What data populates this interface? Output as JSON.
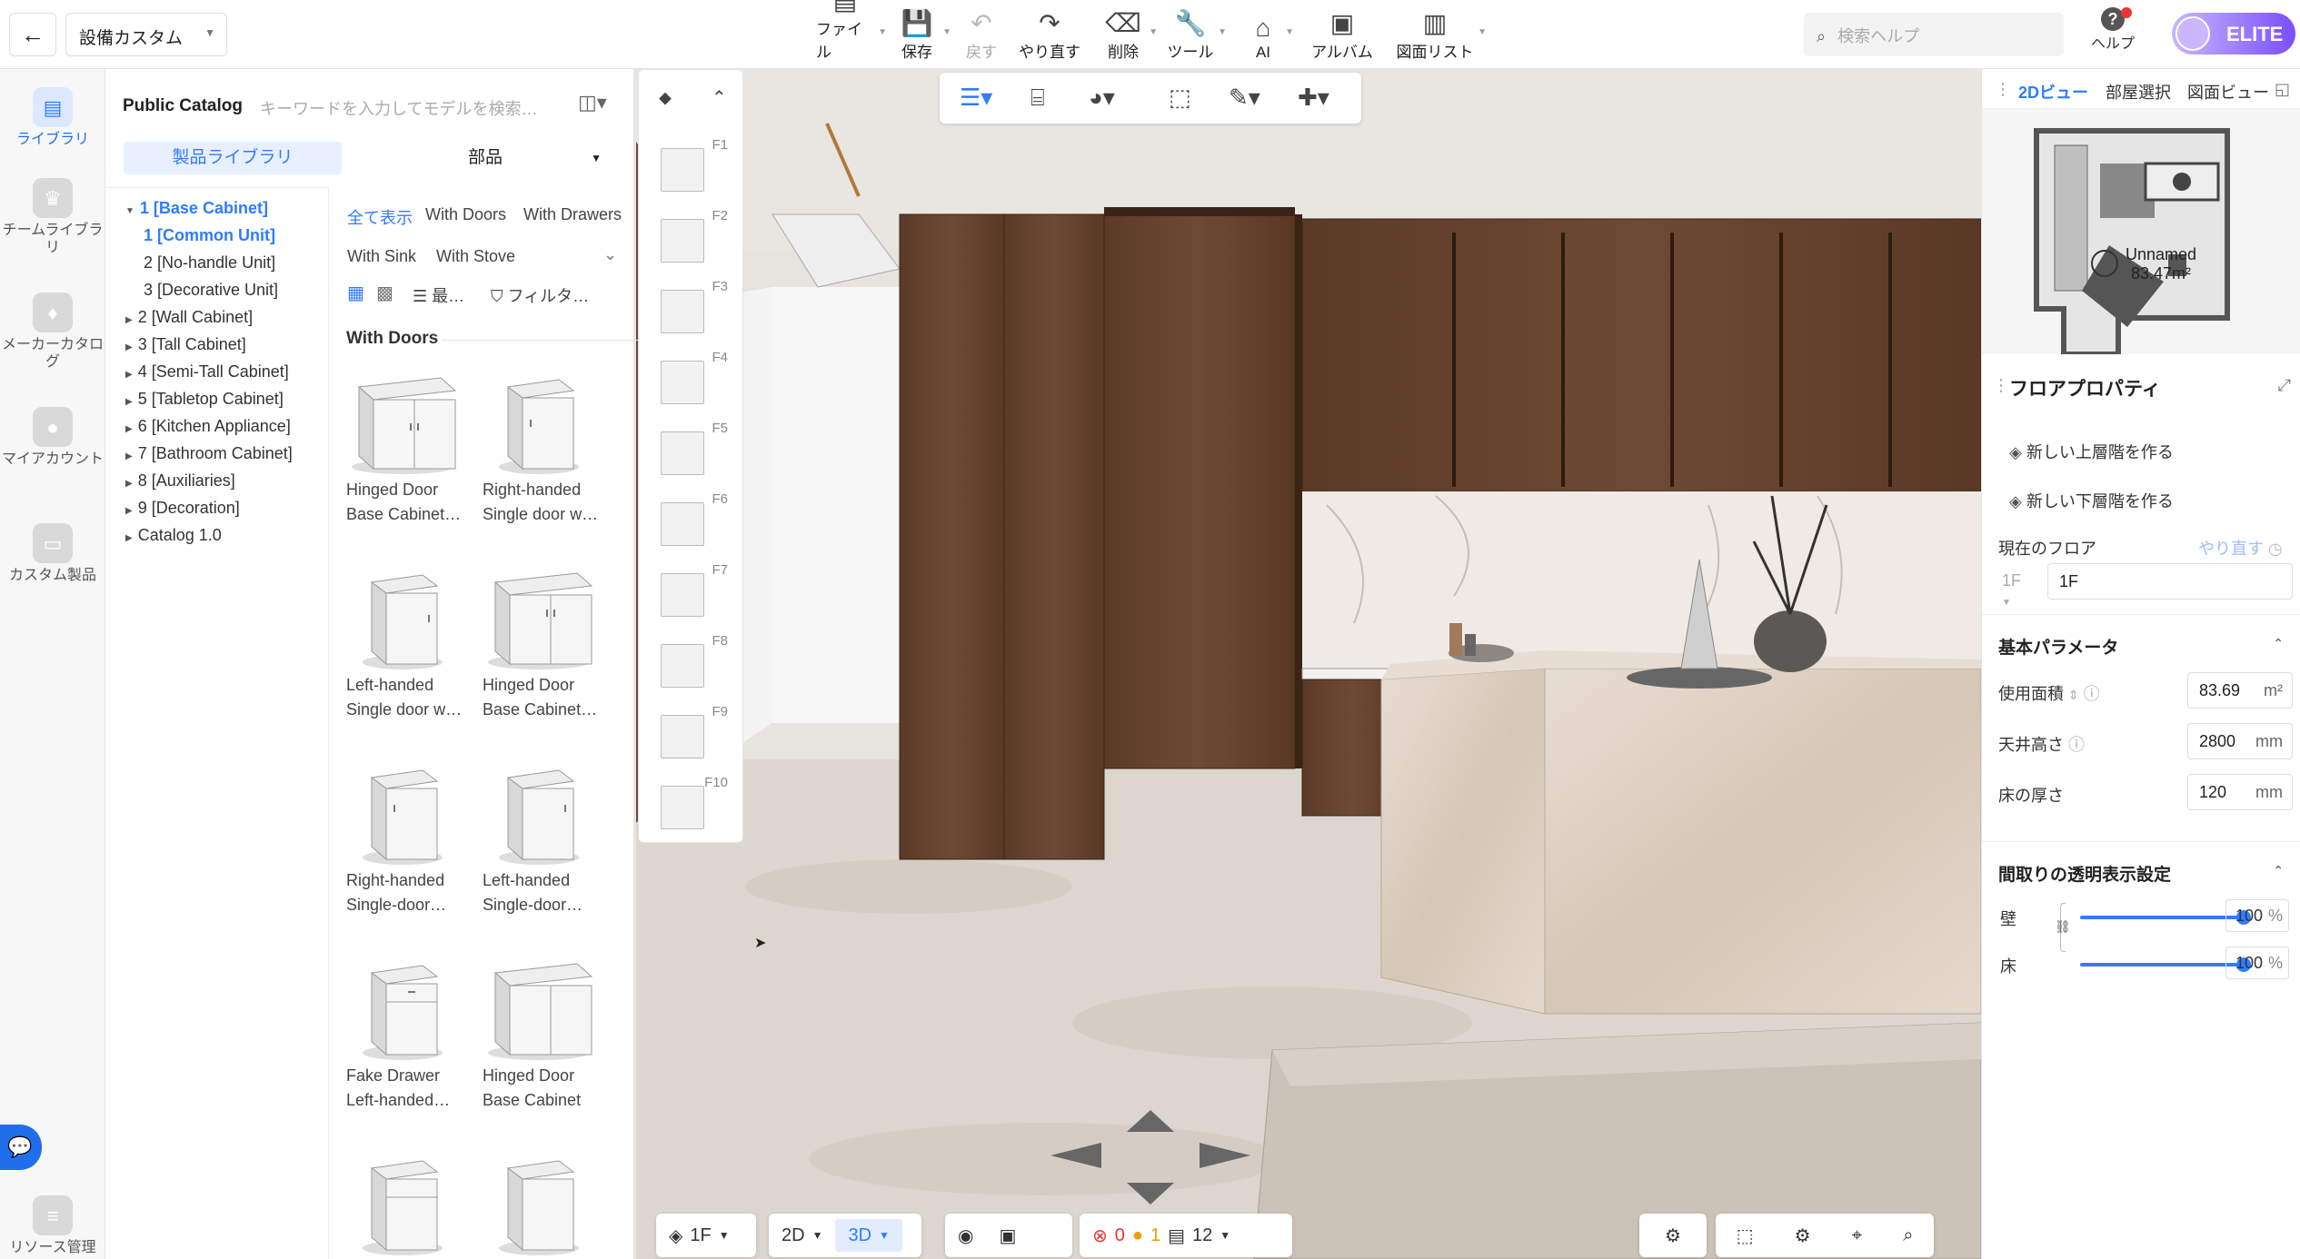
{
  "topbar": {
    "project": "設備カスタム",
    "items": [
      {
        "label": "ファイル",
        "icon": "file-icon"
      },
      {
        "label": "保存",
        "icon": "save-icon"
      },
      {
        "label": "戻す",
        "icon": "undo-icon"
      },
      {
        "label": "やり直す",
        "icon": "redo-icon"
      },
      {
        "label": "削除",
        "icon": "eraser-icon"
      },
      {
        "label": "ツール",
        "icon": "wrench-icon"
      },
      {
        "label": "AI",
        "icon": "ai-icon"
      },
      {
        "label": "アルバム",
        "icon": "album-icon"
      },
      {
        "label": "図面リスト",
        "icon": "drawing-list-icon"
      }
    ],
    "search_placeholder": "検索ヘルプ",
    "help_label": "ヘルプ",
    "badge": "ELITE"
  },
  "leftnav": [
    {
      "label": "ライブラリ",
      "icon": "library-icon",
      "active": true
    },
    {
      "label": "チームライブラリ",
      "icon": "team-library-icon"
    },
    {
      "label": "メーカーカタログ",
      "icon": "maker-catalog-icon"
    },
    {
      "label": "マイアカウント",
      "icon": "account-icon"
    },
    {
      "label": "カスタム製品",
      "icon": "custom-product-icon"
    },
    {
      "label": "リソース管理",
      "icon": "resource-icon"
    }
  ],
  "catalog": {
    "title": "Public Catalog",
    "search_placeholder": "キーワードを入力してモデルを検索…",
    "tab_products": "製品ライブラリ",
    "tab_parts": "部品",
    "tree": [
      {
        "label": "1 [Base Cabinet]",
        "expanded": true,
        "active": true
      },
      {
        "label": "1 [Common Unit]",
        "sub": true,
        "active": true
      },
      {
        "label": "2 [No-handle Unit]",
        "sub": true
      },
      {
        "label": "3 [Decorative Unit]",
        "sub": true
      },
      {
        "label": "2 [Wall Cabinet]"
      },
      {
        "label": "3 [Tall Cabinet]"
      },
      {
        "label": "4 [Semi-Tall Cabinet]"
      },
      {
        "label": "5 [Tabletop Cabinet]"
      },
      {
        "label": "6 [Kitchen Appliance]"
      },
      {
        "label": "7 [Bathroom Cabinet]"
      },
      {
        "label": "8 [Auxiliaries]"
      },
      {
        "label": "9 [Decoration]"
      },
      {
        "label": "Catalog 1.0"
      }
    ],
    "filter_chips": [
      "全て表示",
      "With Doors",
      "With Drawers",
      "With Sink",
      "With Stove"
    ],
    "sort_label": "最…",
    "filter_label": "フィルタ…",
    "group_title": "With Doors",
    "products": [
      {
        "line1": "Hinged Door",
        "line2": "Base Cabinet…"
      },
      {
        "line1": "Right-handed",
        "line2": "Single door w…"
      },
      {
        "line1": "Left-handed",
        "line2": "Single door w…"
      },
      {
        "line1": "Hinged Door",
        "line2": "Base Cabinet…"
      },
      {
        "line1": "Right-handed",
        "line2": "Single-door…"
      },
      {
        "line1": "Left-handed",
        "line2": "Single-door…"
      },
      {
        "line1": "Fake Drawer",
        "line2": "Left-handed…"
      },
      {
        "line1": "Hinged Door",
        "line2": "Base Cabinet"
      }
    ]
  },
  "floors": [
    "F1",
    "F2",
    "F3",
    "F4",
    "F5",
    "F6",
    "F7",
    "F8",
    "F9",
    "F10"
  ],
  "rightpanel": {
    "tabs": [
      "2Dビュー",
      "部屋選択",
      "図面ビュー"
    ],
    "room_name": "Unnamed",
    "room_area": "83.47m²",
    "floor_props_title": "フロアプロパティ",
    "new_upper": "新しい上層階を作る",
    "new_lower": "新しい下層階を作る",
    "current_floor_label": "現在のフロア",
    "redo_label": "やり直す",
    "floor_select": "1F",
    "floor_name": "1F",
    "basic_params": "基本パラメータ",
    "area_label": "使用面積",
    "area_value": "83.69",
    "area_unit": "m²",
    "ceiling_label": "天井高さ",
    "ceiling_value": "2800",
    "ceiling_unit": "mm",
    "floor_thick_label": "床の厚さ",
    "floor_thick_value": "120",
    "floor_thick_unit": "mm",
    "transparency_title": "間取りの透明表示設定",
    "wall_label": "壁",
    "wall_value": "100",
    "floor_label": "床",
    "floor_value": "100",
    "pct": "%"
  },
  "bottombar": {
    "floor": "1F",
    "view2d": "2D",
    "view3d": "3D",
    "errors": "0",
    "warnings": "1",
    "count": "12"
  }
}
